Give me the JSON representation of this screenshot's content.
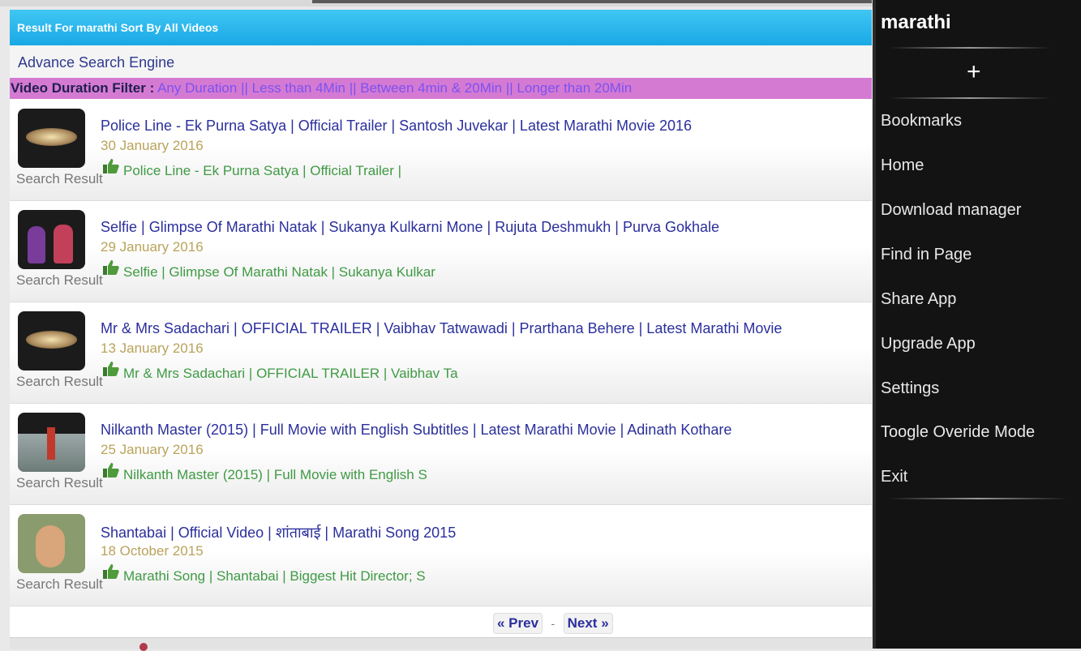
{
  "header": {
    "result_text": "Result For marathi Sort By All Videos",
    "advance_search": "Advance Search Engine"
  },
  "filter": {
    "label": "Video Duration Filter :",
    "options": [
      "Any Duration",
      "Less than 4Min",
      "Between 4min & 20Min",
      "Longer than 20Min"
    ],
    "separator": "||"
  },
  "results": [
    {
      "title": "Police Line - Ek Purna Satya | Official Trailer | Santosh Juvekar | Latest Marathi Movie 2016",
      "date": "30 January 2016",
      "desc": "Police Line - Ek Purna Satya | Official Trailer |",
      "caption": "Search Result",
      "thumb": "logo"
    },
    {
      "title": "Selfie | Glimpse Of Marathi Natak | Sukanya Kulkarni Mone | Rujuta Deshmukh | Purva Gokhale",
      "date": "29 January 2016",
      "desc": "Selfie | Glimpse Of Marathi Natak | Sukanya Kulkar",
      "caption": "Search Result",
      "thumb": "people"
    },
    {
      "title": "Mr & Mrs Sadachari | OFFICIAL TRAILER | Vaibhav Tatwawadi | Prarthana Behere | Latest Marathi Movie",
      "date": "13 January 2016",
      "desc": "Mr & Mrs Sadachari | OFFICIAL TRAILER | Vaibhav Ta",
      "caption": "Search Result",
      "thumb": "logo"
    },
    {
      "title": "Nilkanth Master (2015) | Full Movie with English Subtitles | Latest Marathi Movie | Adinath Kothare",
      "date": "25 January 2016",
      "desc": "Nilkanth Master (2015) | Full Movie with English S",
      "caption": "Search Result",
      "thumb": "sea"
    },
    {
      "title": "Shantabai | Official Video | शांताबाई | Marathi Song 2015",
      "date": "18 October 2015",
      "desc": "Marathi Song | Shantabai | Biggest Hit Director; S",
      "caption": "Search Result",
      "thumb": "face"
    }
  ],
  "pager": {
    "prev": "« Prev",
    "dash": "-",
    "next": "Next »"
  },
  "menu": {
    "title": "marathi",
    "plus": "+",
    "items": [
      "Bookmarks",
      "Home",
      "Download manager",
      "Find in Page",
      "Share App",
      "Upgrade App",
      "Settings",
      "Toogle Overide Mode",
      "Exit"
    ]
  },
  "colors": {
    "header_bg": "#1aa9e6",
    "filter_bg": "#d57ad3",
    "title_color": "#2b2f9c",
    "date_color": "#b9a35b",
    "desc_color": "#3f9a44",
    "menu_bg": "#131313"
  }
}
